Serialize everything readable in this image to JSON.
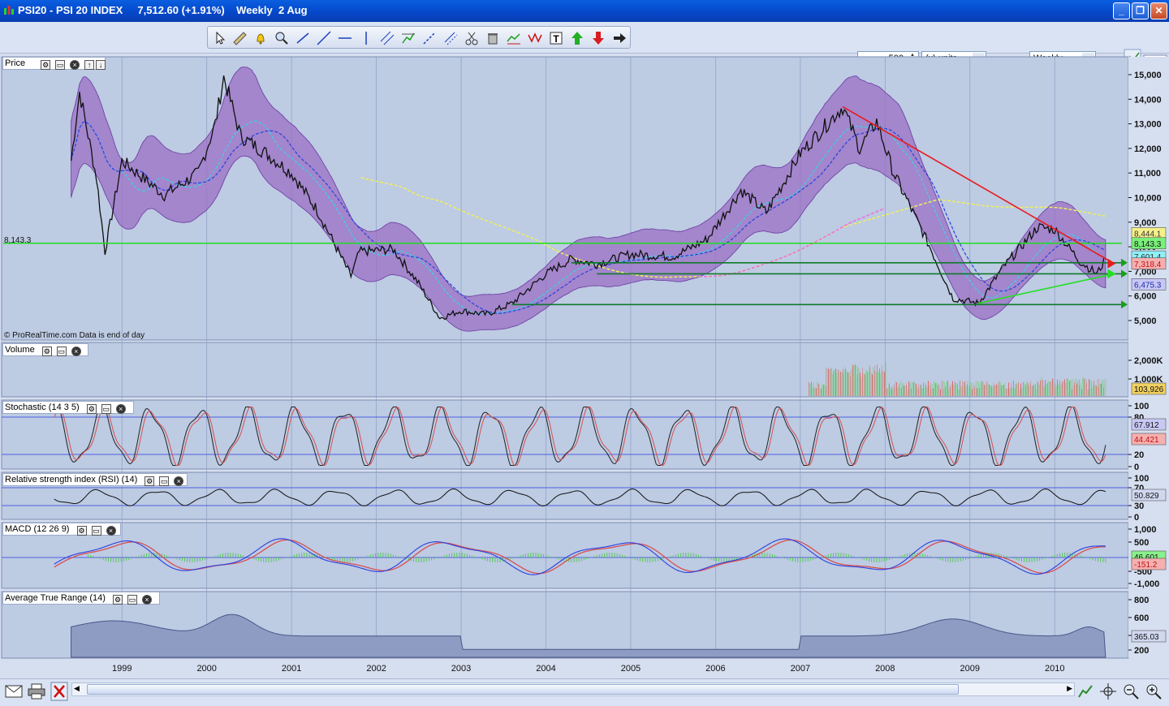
{
  "window": {
    "title": "PSI20 - PSI 20 INDEX     7,512.60 (+1.91%)    Weekly  2 Aug",
    "minimize": "_",
    "maximize": "❐",
    "close": "✕"
  },
  "toolbar": {
    "tools": [
      "pointer",
      "ruler",
      "alert-bell",
      "zoom-magnifier",
      "line",
      "segment",
      "horizontal-line",
      "vertical-line",
      "channel",
      "fibonacci",
      "trend",
      "parallel",
      "scissors",
      "trash",
      "buy-sell",
      "zigzag",
      "text",
      "buy-arrow",
      "sell-arrow",
      "arrow"
    ],
    "size_value": "500",
    "units": "(x) units",
    "timeframe": "Weekly"
  },
  "colors": {
    "background": "#bdcbe3",
    "bollinger_fill": "#9b6fc4",
    "sma_cyan": "#35d5e8",
    "ema_blue": "#2b3fe0",
    "sma_yellow": "#f0ef5a",
    "sma_pink": "#ee6cda",
    "green_line": "#1edc1e",
    "red_trendline": "#e81c1c",
    "support_dark_green": "#0f7a2a"
  },
  "price_panel": {
    "label": "Price",
    "copyright": "© ProRealTime.com  Data is end of day",
    "level_8143": "8,143.3",
    "yaxis_ticks": [
      "15,000",
      "14,000",
      "13,000",
      "12,000",
      "11,000",
      "10,000",
      "9,000",
      "8,000",
      "7,000",
      "6,000",
      "5,000"
    ],
    "badges": {
      "yellow": "8,444.1",
      "green": "8,143.3",
      "cyan": "7,601.4",
      "price": "7,512.6",
      "red": "7,318.4",
      "blue": "6,475.3"
    }
  },
  "volume_panel": {
    "label": "Volume",
    "yaxis_ticks": [
      "2,000K",
      "1,000K"
    ],
    "badge": "103,926"
  },
  "stochastic_panel": {
    "label": "Stochastic (14 3 5)",
    "yaxis_ticks": [
      "100",
      "80",
      "20",
      "0"
    ],
    "badge_k": "67.912",
    "badge_d": "44.421"
  },
  "rsi_panel": {
    "label": "Relative strength index (RSI) (14)",
    "yaxis_ticks": [
      "100",
      "70",
      "30",
      "0"
    ],
    "badge": "50.829"
  },
  "macd_panel": {
    "label": "MACD (12 26 9)",
    "yaxis_ticks": [
      "1,000",
      "500",
      "-500",
      "-1,000"
    ],
    "badge_macd": "46.601",
    "badge_signal": "-151.2"
  },
  "atr_panel": {
    "label": "Average True Range (14)",
    "yaxis_ticks": [
      "800",
      "600",
      "400",
      "200"
    ],
    "badge": "365.03"
  },
  "xaxis_years": [
    "1999",
    "2000",
    "2001",
    "2002",
    "2003",
    "2004",
    "2005",
    "2006",
    "2007",
    "2008",
    "2009",
    "2010"
  ],
  "chart_data": {
    "type": "line",
    "title": "PSI20 - PSI 20 INDEX",
    "timeframe": "Weekly",
    "last_close": 7512.6,
    "change_percent": 1.91,
    "x_range": [
      "1998",
      "2010"
    ],
    "y_range": [
      4500,
      15500
    ],
    "price_series": [
      {
        "x": 1998.4,
        "y": 11500
      },
      {
        "x": 1998.5,
        "y": 14300
      },
      {
        "x": 1998.7,
        "y": 10800
      },
      {
        "x": 1998.8,
        "y": 7800
      },
      {
        "x": 1999.0,
        "y": 11500
      },
      {
        "x": 1999.5,
        "y": 10100
      },
      {
        "x": 1999.9,
        "y": 11000
      },
      {
        "x": 2000.1,
        "y": 13000
      },
      {
        "x": 2000.2,
        "y": 14900
      },
      {
        "x": 2000.4,
        "y": 12500
      },
      {
        "x": 2000.7,
        "y": 11800
      },
      {
        "x": 2001.0,
        "y": 11000
      },
      {
        "x": 2001.3,
        "y": 9500
      },
      {
        "x": 2001.7,
        "y": 6800
      },
      {
        "x": 2001.8,
        "y": 7800
      },
      {
        "x": 2002.2,
        "y": 7900
      },
      {
        "x": 2002.5,
        "y": 6500
      },
      {
        "x": 2002.75,
        "y": 5100
      },
      {
        "x": 2003.0,
        "y": 5400
      },
      {
        "x": 2003.3,
        "y": 5250
      },
      {
        "x": 2003.6,
        "y": 5700
      },
      {
        "x": 2004.0,
        "y": 6900
      },
      {
        "x": 2004.3,
        "y": 7500
      },
      {
        "x": 2004.6,
        "y": 7300
      },
      {
        "x": 2005.0,
        "y": 7700
      },
      {
        "x": 2005.5,
        "y": 7600
      },
      {
        "x": 2005.9,
        "y": 8300
      },
      {
        "x": 2006.3,
        "y": 10300
      },
      {
        "x": 2006.6,
        "y": 9400
      },
      {
        "x": 2007.0,
        "y": 11800
      },
      {
        "x": 2007.5,
        "y": 13700
      },
      {
        "x": 2007.7,
        "y": 12000
      },
      {
        "x": 2007.9,
        "y": 13100
      },
      {
        "x": 2008.1,
        "y": 11000
      },
      {
        "x": 2008.5,
        "y": 8200
      },
      {
        "x": 2008.8,
        "y": 5900
      },
      {
        "x": 2009.1,
        "y": 5700
      },
      {
        "x": 2009.4,
        "y": 7200
      },
      {
        "x": 2009.8,
        "y": 8800
      },
      {
        "x": 2010.0,
        "y": 8700
      },
      {
        "x": 2010.3,
        "y": 7400
      },
      {
        "x": 2010.5,
        "y": 6900
      },
      {
        "x": 2010.6,
        "y": 7512.6
      }
    ],
    "horizontal_levels": [
      8143.3,
      7350,
      6900,
      5650
    ],
    "trendlines": [
      {
        "color": "red",
        "from": {
          "x": 2007.5,
          "y": 13700
        },
        "to": {
          "x": 2010.7,
          "y": 7318.4
        }
      },
      {
        "color": "green",
        "from": {
          "x": 2009.1,
          "y": 5700
        },
        "to": {
          "x": 2010.7,
          "y": 6900
        }
      }
    ]
  }
}
